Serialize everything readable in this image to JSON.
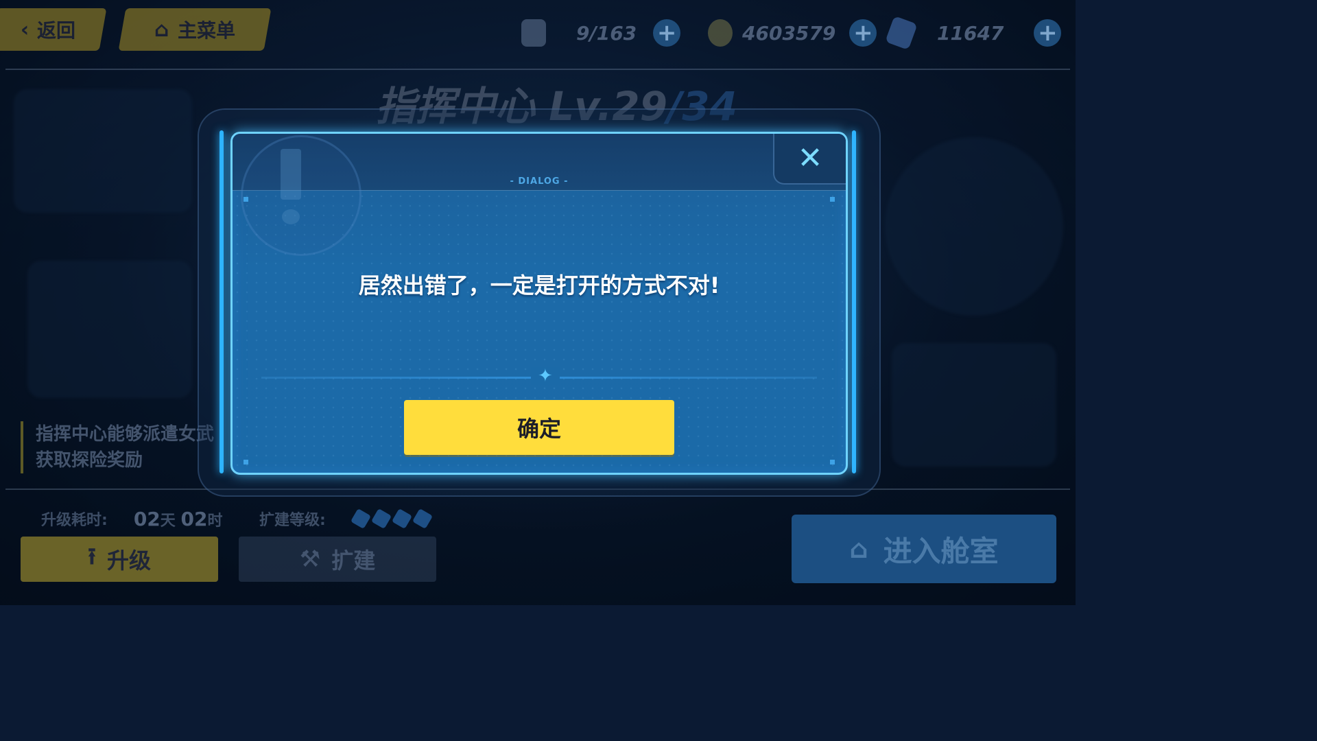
{
  "topbar": {
    "back_label": "返回",
    "menu_label": "主菜单",
    "resources": [
      {
        "icon": "stamina-icon",
        "value": "9/163"
      },
      {
        "icon": "coin-icon",
        "value": "4603579"
      },
      {
        "icon": "crystal-icon",
        "value": "11647"
      }
    ]
  },
  "building": {
    "name": "指挥中心",
    "level_current": "Lv.29",
    "level_max": "/34",
    "description_line1": "指挥中心能够派遣女武",
    "description_line2": "获取探险奖励"
  },
  "footer": {
    "upgrade_time_label": "升级耗时:",
    "upgrade_time_days": "02",
    "upgrade_time_days_unit": "天",
    "upgrade_time_hours": "02",
    "upgrade_time_hours_unit": "时",
    "expand_level_label": "扩建等级:",
    "expand_level_count": 4,
    "upgrade_button": "升级",
    "expand_button": "扩建",
    "enter_button": "进入舱室"
  },
  "dialog": {
    "tag": "- DIALOG -",
    "message": "居然出错了，一定是打开的方式不对!",
    "confirm_label": "确定"
  },
  "colors": {
    "accent_yellow": "#ffdd3c",
    "dialog_border": "#6fd3ff",
    "dialog_bg": "#1c6aa8"
  }
}
